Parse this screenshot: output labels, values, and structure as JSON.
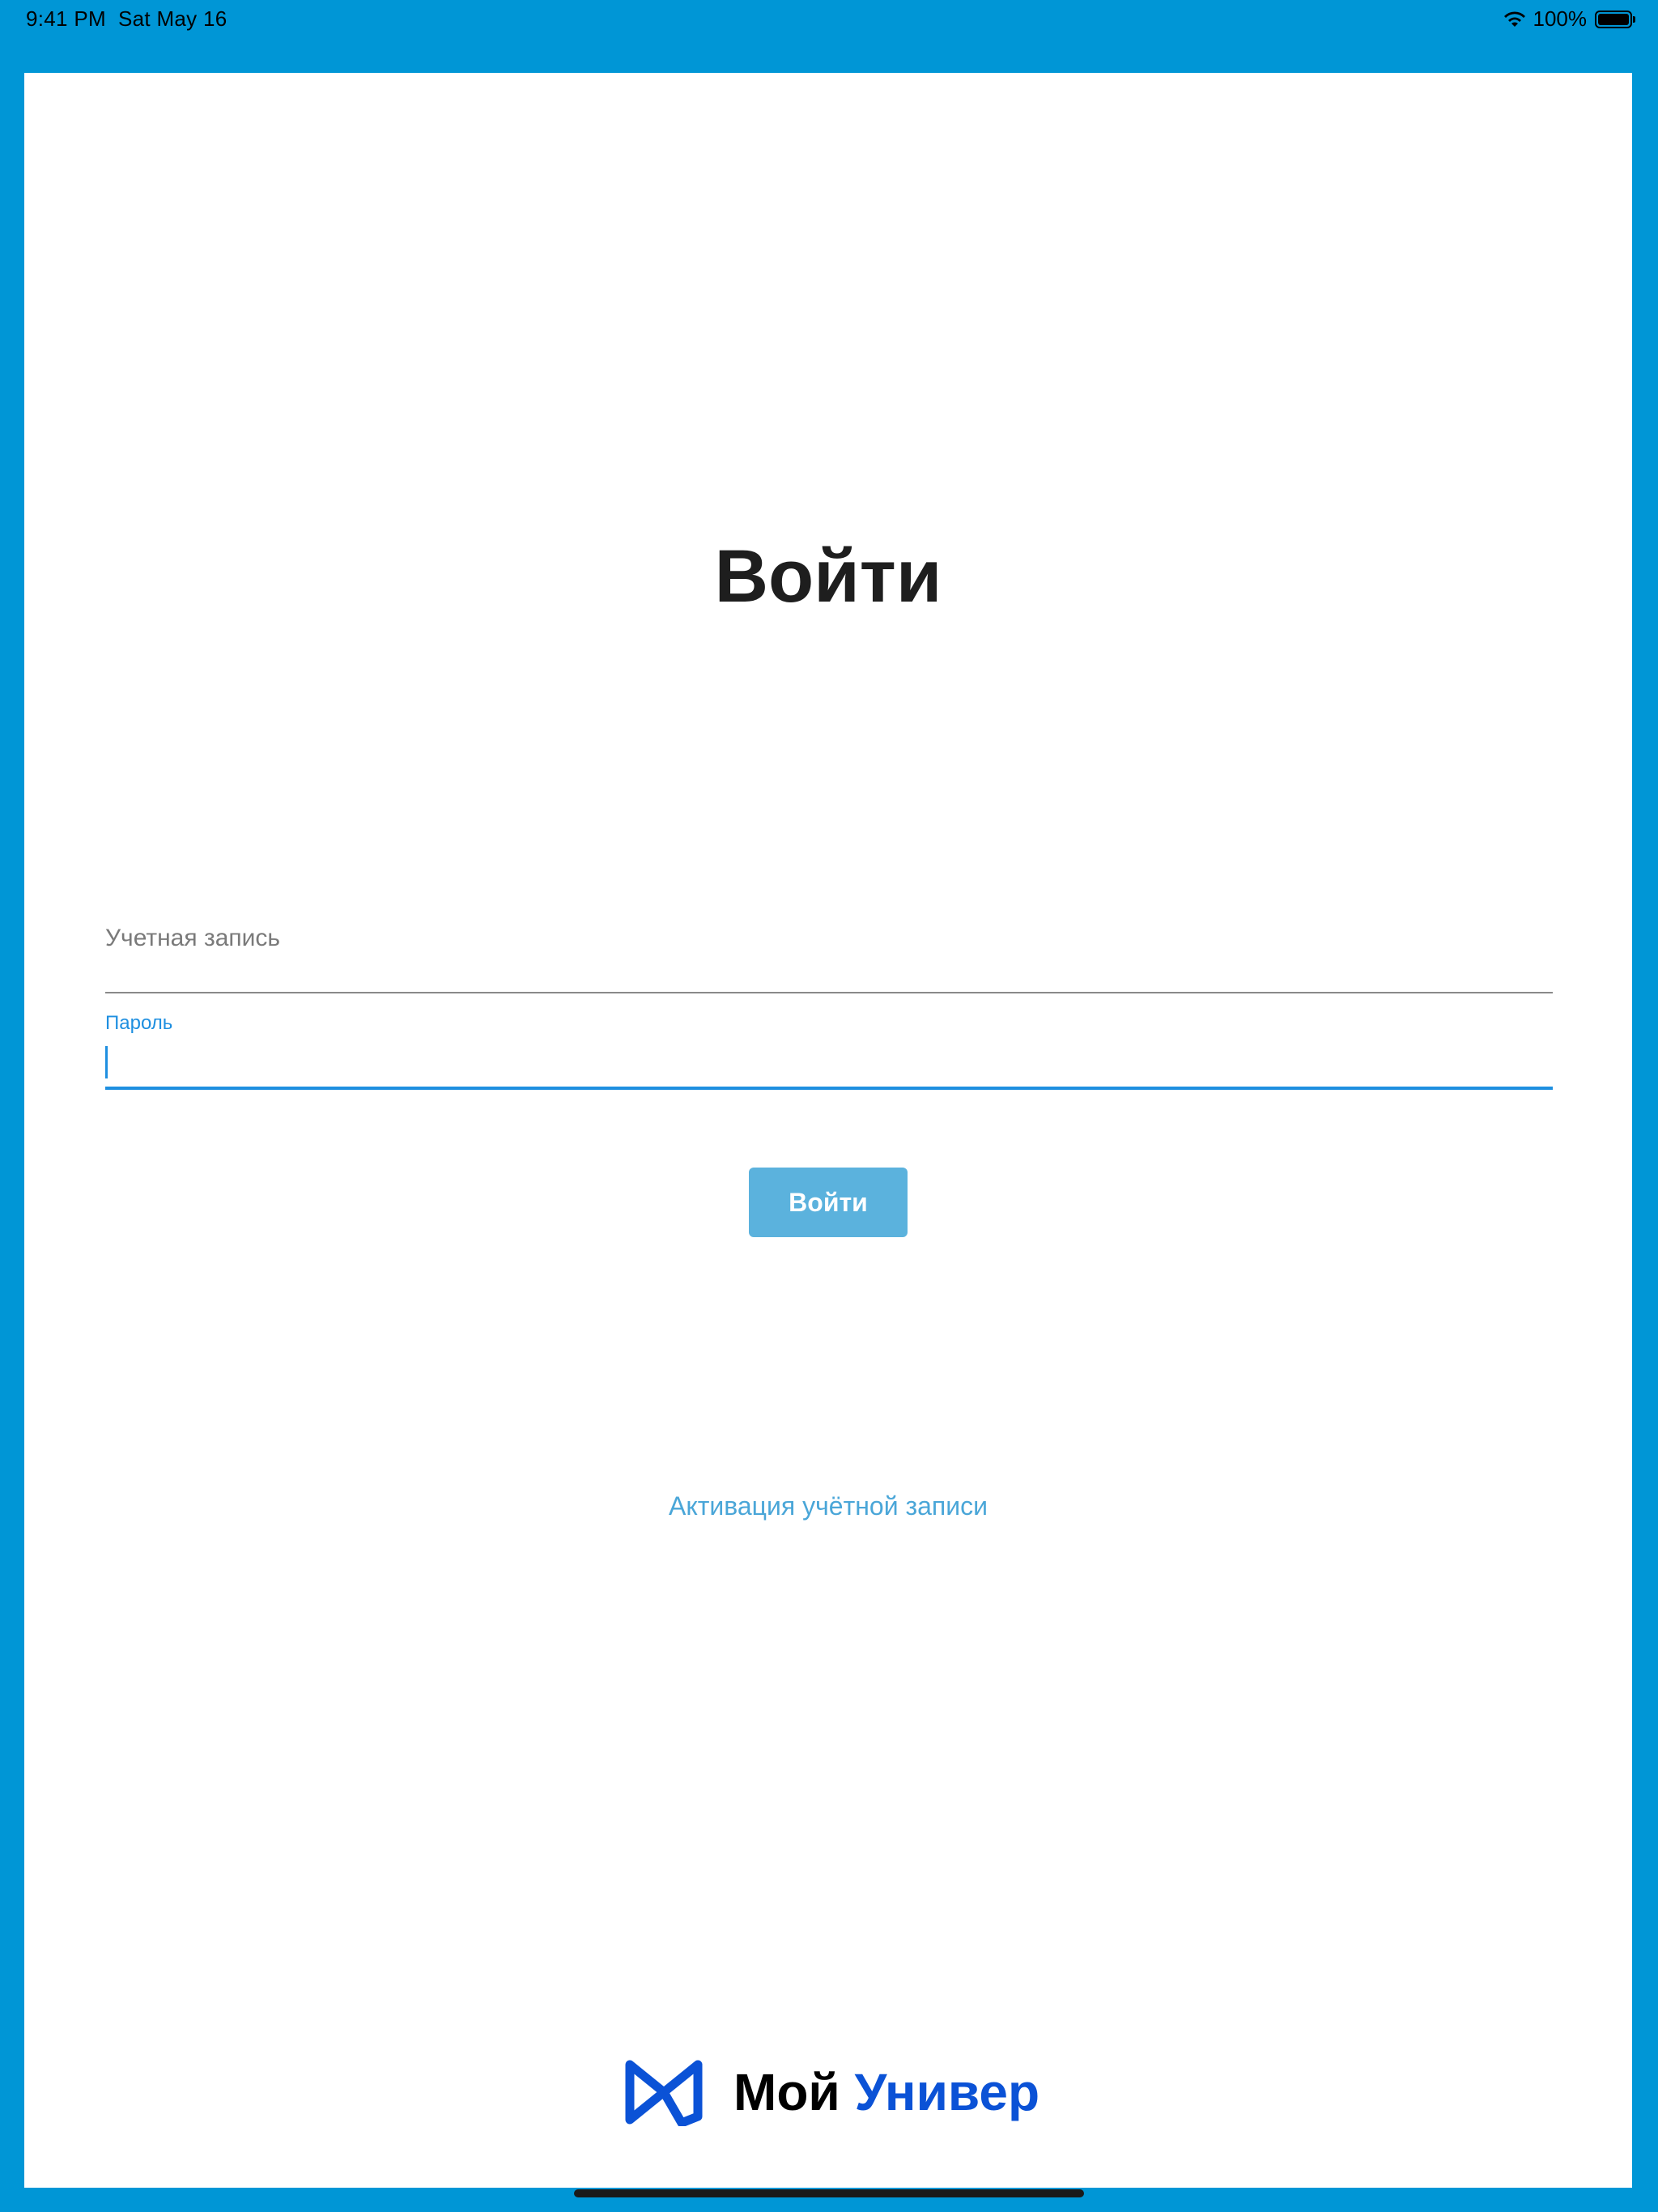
{
  "status_bar": {
    "time": "9:41 PM",
    "date": "Sat May 16",
    "battery_text": "100%",
    "icons": [
      "wifi-icon",
      "battery-icon"
    ]
  },
  "login": {
    "title": "Войти",
    "account_field": {
      "placeholder": "Учетная запись",
      "value": ""
    },
    "password_field": {
      "label": "Пароль",
      "value": "",
      "focused": true
    },
    "submit_label": "Войти",
    "activation_link": "Активация учётной записи"
  },
  "brand": {
    "icon": "moy-univer-logo-icon",
    "name_part_1": "Мой",
    "name_part_2": "Универ",
    "colors": {
      "frame": "#0096D6",
      "accent": "#1e8fe0",
      "button": "#5bb2dd",
      "link": "#4aa6d8",
      "logo_blue": "#0b52d6"
    }
  }
}
